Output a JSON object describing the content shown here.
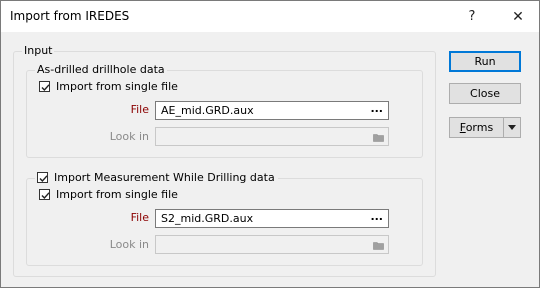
{
  "window": {
    "title": "Import from IREDES",
    "help_glyph": "?",
    "close_glyph": "✕"
  },
  "input_group": {
    "legend": "Input",
    "drillhole": {
      "legend": "As-drilled drillhole data",
      "single_file_label": "Import from single file",
      "single_file_checked": true,
      "file_label": "File",
      "file_value": "AE_mid.GRD.aux",
      "browse_label": "...",
      "lookin_label": "Look in",
      "lookin_value": ""
    },
    "mwd": {
      "checkbox_label": "Import Measurement While Drilling data",
      "checkbox_checked": true,
      "single_file_label": "Import from single file",
      "single_file_checked": true,
      "file_label": "File",
      "file_value": "S2_mid.GRD.aux",
      "browse_label": "...",
      "lookin_label": "Look in",
      "lookin_value": ""
    }
  },
  "buttons": {
    "run": "Run",
    "close": "Close",
    "forms_first": "F",
    "forms_rest": "orms"
  },
  "icons": {
    "checkbox": "checkmark-icon",
    "folder": "folder-icon",
    "dropdown": "chevron-down-icon"
  }
}
